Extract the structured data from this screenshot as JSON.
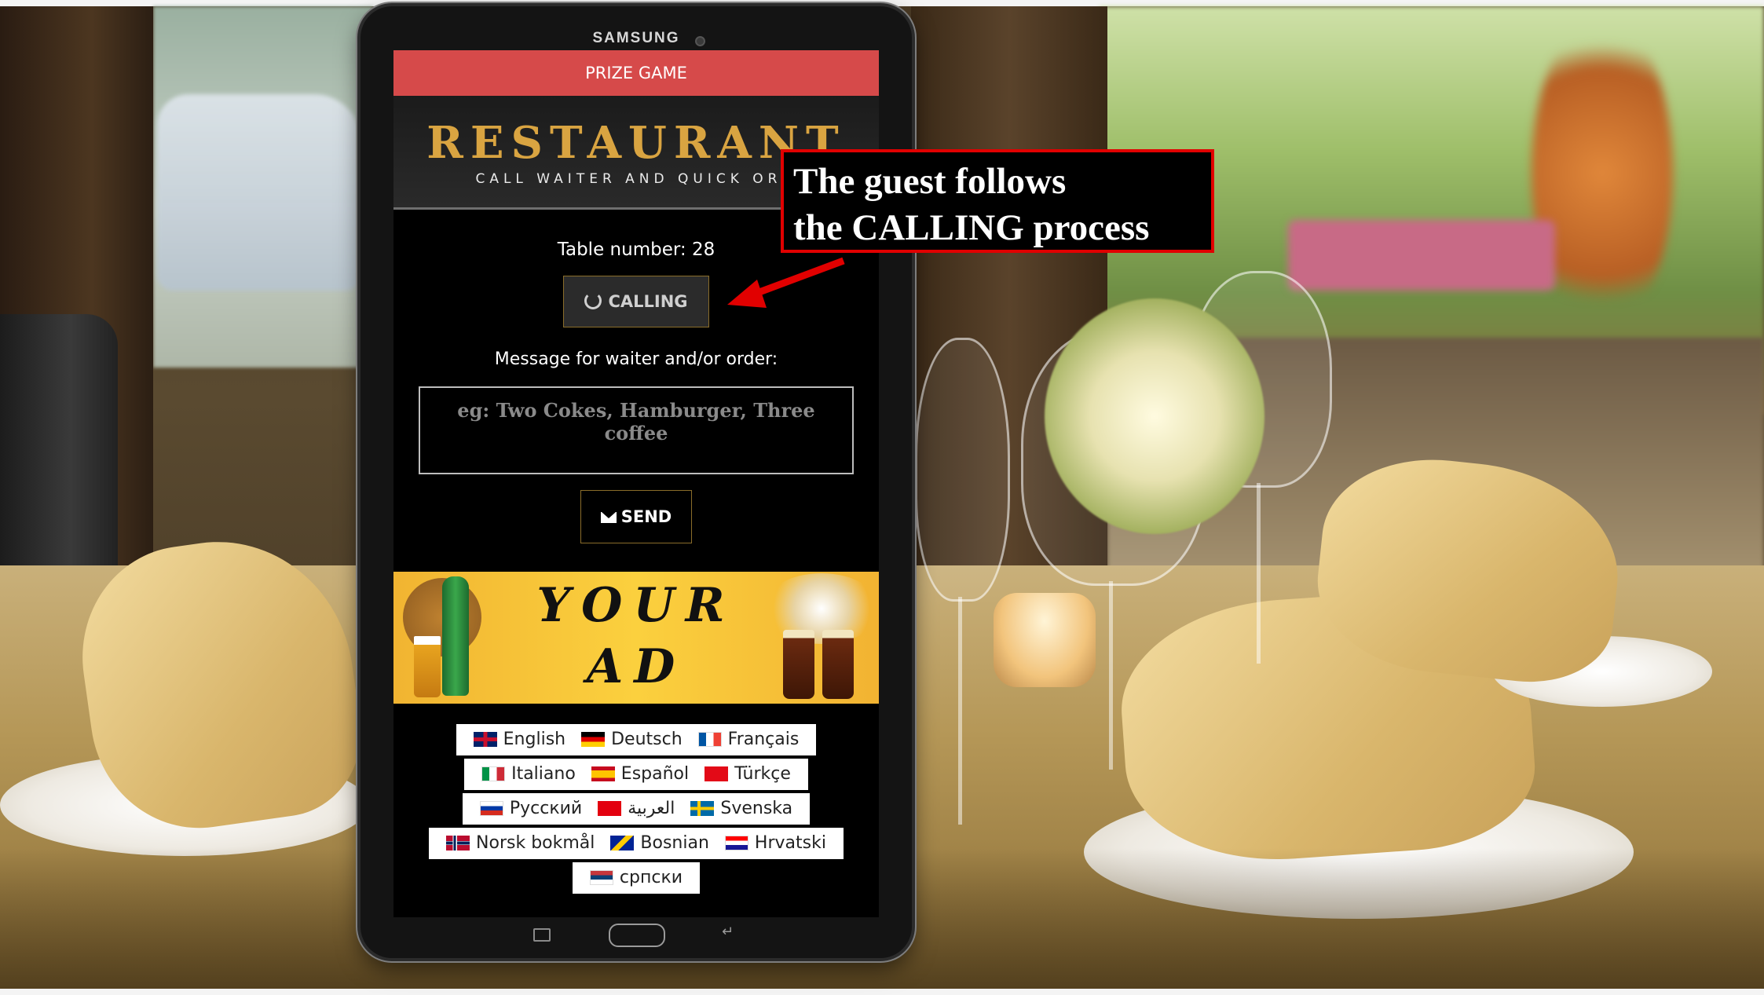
{
  "tablet": {
    "brand": "SAMSUNG"
  },
  "page": {
    "prize_bar": "PRIZE GAME",
    "header": {
      "title": "RESTAURANT",
      "subtitle": "CALL WAITER AND QUICK ORD"
    },
    "table_number": "Table number: 28",
    "calling_button": "CALLING",
    "message_label": "Message for waiter and/or order:",
    "message_placeholder": "eg: Two Cokes, Hamburger, Three coffee",
    "send_button": "SEND",
    "ad": {
      "line1": "YOUR",
      "line2": "AD"
    },
    "languages": [
      [
        "English",
        "Deutsch",
        "Français"
      ],
      [
        "Italiano",
        "Español",
        "Türkçe"
      ],
      [
        "Русский",
        "العربية",
        "Svenska"
      ],
      [
        "Norsk bokmål",
        "Bosnian",
        "Hrvatski"
      ],
      [
        "српски"
      ]
    ]
  },
  "callout": {
    "line1": "The guest follows",
    "line2": "the CALLING process"
  },
  "colors": {
    "prize_bar": "#d64a4a",
    "title_gold": "#d9a441",
    "callout_border": "#e10000",
    "ad_yellow": "#fbd03e"
  },
  "icons": [
    "spinner-icon",
    "envelope-icon",
    "flag-gb-icon",
    "flag-de-icon",
    "flag-fr-icon",
    "flag-it-icon",
    "flag-es-icon",
    "flag-tr-icon",
    "flag-ru-icon",
    "flag-ar-icon",
    "flag-se-icon",
    "flag-no-icon",
    "flag-ba-icon",
    "flag-hr-icon",
    "flag-rs-icon"
  ]
}
